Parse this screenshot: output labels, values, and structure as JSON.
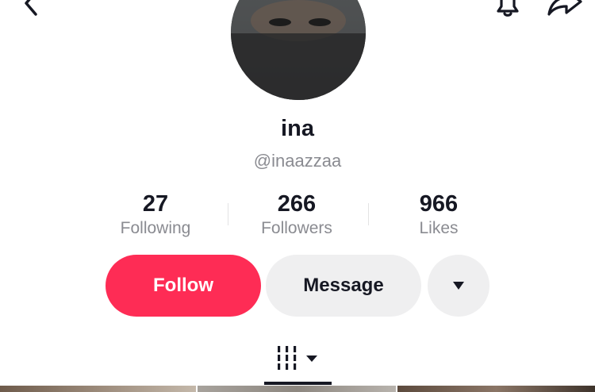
{
  "profile": {
    "name": "ina",
    "handle": "@inaazzaa"
  },
  "stats": {
    "following": {
      "value": "27",
      "label": "Following"
    },
    "followers": {
      "value": "266",
      "label": "Followers"
    },
    "likes": {
      "value": "966",
      "label": "Likes"
    }
  },
  "actions": {
    "follow_label": "Follow",
    "message_label": "Message"
  },
  "icons": {
    "back": "chevron-left-icon",
    "bell": "bell-icon",
    "share": "share-icon",
    "more": "caret-down-icon",
    "videos_tab": "grid-icon"
  },
  "colors": {
    "accent": "#fe2c55",
    "text_primary": "#161823",
    "text_secondary": "#8a8b91",
    "button_secondary": "#efeff0"
  }
}
